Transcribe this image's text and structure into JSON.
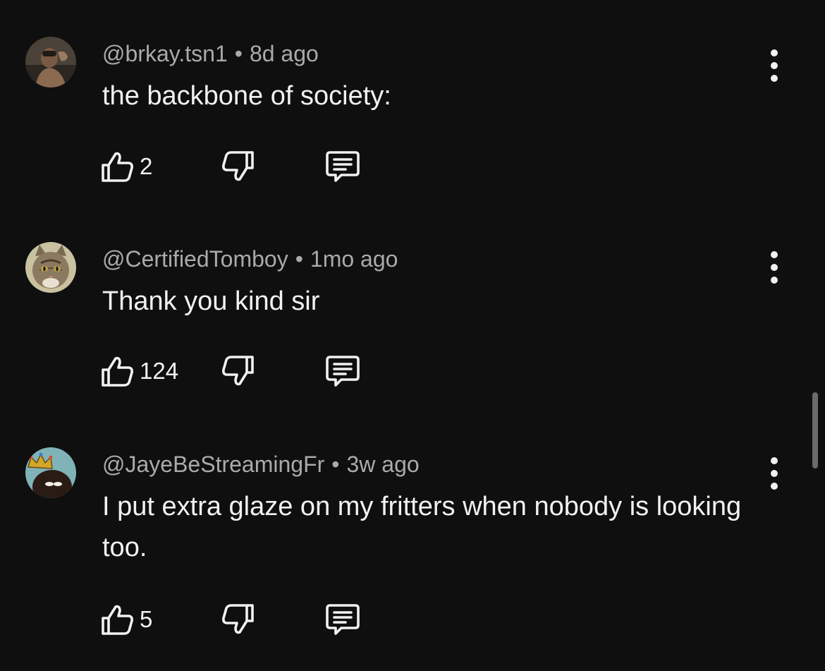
{
  "comments": [
    {
      "author": "@brkay.tsn1",
      "time": "8d ago",
      "text": "the backbone of society:",
      "likes": "2",
      "avatar_icon": "person-photo-avatar"
    },
    {
      "author": "@CertifiedTomboy",
      "time": "1mo ago",
      "text": "Thank you kind sir",
      "likes": "124",
      "avatar_icon": "cat-photo-avatar"
    },
    {
      "author": "@JayeBeStreamingFr",
      "time": "3w ago",
      "text": "I put extra glaze on my fritters when nobody is looking too.",
      "likes": "5",
      "avatar_icon": "crowned-face-avatar"
    }
  ],
  "separator": "•",
  "icons": {
    "like": "thumbs-up-icon",
    "dislike": "thumbs-down-icon",
    "reply": "reply-comment-icon",
    "more": "more-vert-icon"
  },
  "colors": {
    "background": "#0f0f0f",
    "text": "#f1f1f1",
    "meta": "#aaaaaa",
    "scrollbar": "#6b6b6b"
  }
}
